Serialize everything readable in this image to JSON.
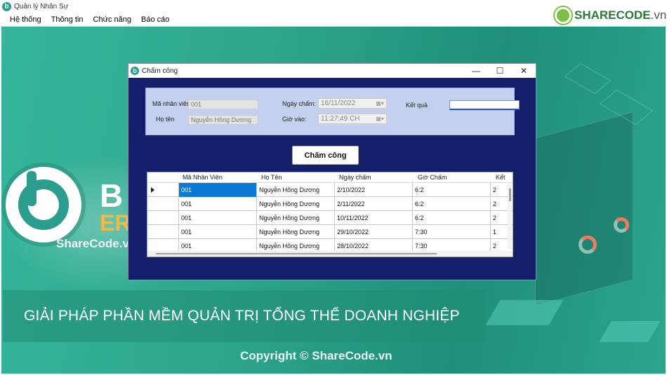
{
  "app": {
    "title": "Quản lý Nhân Sự",
    "logo_letter": "b"
  },
  "menu": [
    "Hệ thống",
    "Thông tin",
    "Chức năng",
    "Báo cáo"
  ],
  "background": {
    "brand_b": "B",
    "brand_er": "ER",
    "watermark_left": "ShareCode.vn",
    "banner": "GIẢI PHÁP PHẦN MỀM QUẢN TRỊ TỔNG THỂ DOANH NGHIỆP",
    "watermark_bottom": "Copyright © ShareCode.vn",
    "sharecode_brand": "SHARECODE",
    "sharecode_domain": ".vn",
    "accent": "#2ea88d"
  },
  "dialog": {
    "title": "Chấm công",
    "controls": {
      "minimize": "—",
      "maximize": "☐",
      "close": "✕"
    },
    "form": {
      "employee_id_label": "Mã nhân viên",
      "employee_id_value": "001",
      "name_label": "Họ tên",
      "name_value": "Nguyễn Hồng Dương",
      "date_label": "Ngày chấm:",
      "date_value": "16/11/2022",
      "time_label": "Giờ vào:",
      "time_value": "11:27:49 CH",
      "result_label": "Kết quả",
      "result_value": ""
    },
    "submit_label": "Chấm công",
    "table": {
      "columns": [
        "Mã Nhân Viên",
        "Họ Tên",
        "Ngày chấm",
        "Giờ Chấm",
        "Kết"
      ],
      "rows": [
        [
          "001",
          "Nguyễn Hồng Dương",
          "2/10/2022",
          "6:2",
          "2"
        ],
        [
          "001",
          "Nguyễn Hồng Dương",
          "2/11/2022",
          "6:2",
          "2"
        ],
        [
          "001",
          "Nguyễn Hồng Dương",
          "10/11/2022",
          "6:2",
          "2"
        ],
        [
          "001",
          "Nguyễn Hồng Dương",
          "29/10/2022",
          "7:30",
          "1"
        ],
        [
          "001",
          "Nguyễn Hồng Dương",
          "28/10/2022",
          "7:30",
          "2"
        ]
      ]
    }
  }
}
